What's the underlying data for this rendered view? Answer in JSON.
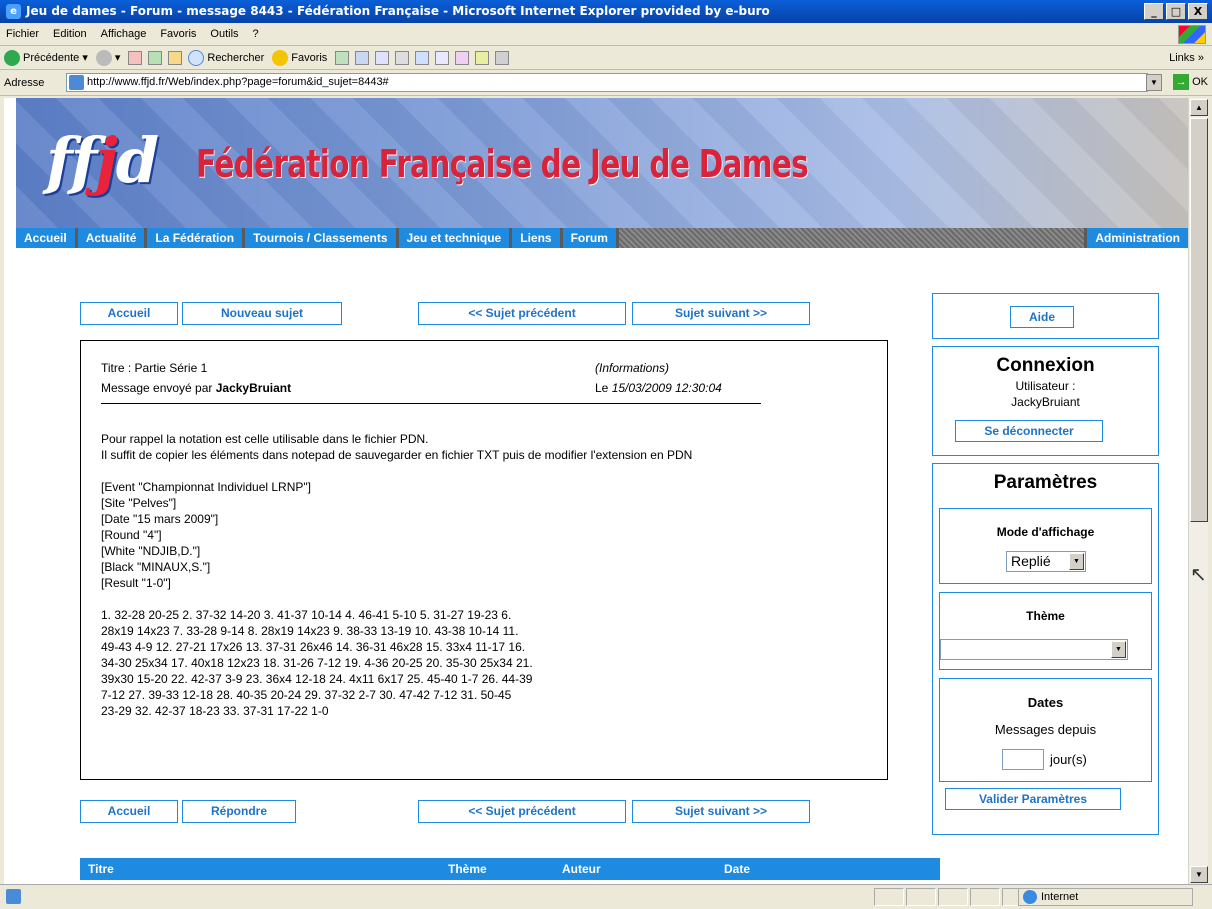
{
  "window": {
    "title": "Jeu de dames - Forum - message 8443 - Fédération Française - Microsoft Internet Explorer provided by e-buro",
    "min": "_",
    "max": "□",
    "close": "X"
  },
  "menu": [
    "Fichier",
    "Edition",
    "Affichage",
    "Favoris",
    "Outils",
    "?"
  ],
  "toolbar": {
    "back": "Précédente",
    "search": "Rechercher",
    "favorites": "Favoris",
    "links": "Links"
  },
  "address": {
    "label": "Adresse",
    "url": "http://www.ffjd.fr/Web/index.php?page=forum&id_sujet=8443#",
    "go": "OK"
  },
  "banner": {
    "logo_a": "ff",
    "logo_b": "j",
    "logo_c": "d",
    "title": "Fédération Française de Jeu de Dames"
  },
  "nav": [
    "Accueil",
    "Actualité",
    "La Fédération",
    "Tournois / Classements",
    "Jeu et technique",
    "Liens",
    "Forum"
  ],
  "nav_admin": "Administration",
  "buttons_top": {
    "home": "Accueil",
    "new_topic": "Nouveau sujet",
    "prev": "<< Sujet précédent",
    "next": "Sujet suivant >>"
  },
  "buttons_bottom": {
    "home": "Accueil",
    "reply": "Répondre",
    "prev": "<< Sujet précédent",
    "next": "Sujet suivant >>"
  },
  "message": {
    "title": "Titre : Partie Série 1",
    "sent_by_label": "Message envoyé par ",
    "author": "JackyBruiant",
    "info": "(Informations)",
    "date_prefix": "Le ",
    "date": "15/03/2009 12:30:04",
    "intro": "Pour rappel la notation est celle utilisable dans le fichier PDN.\nIl suffit de copier les éléments dans notepad de sauvegarder en fichier TXT puis de modifier l'extension en PDN",
    "tags": "[Event \"Championnat Individuel LRNP\"]\n[Site \"Pelves\"]\n[Date \"15 mars 2009\"]\n[Round \"4\"]\n[White \"NDJIB,D.\"]\n[Black \"MINAUX,S.\"]\n[Result \"1-0\"]",
    "moves": "1. 32-28 20-25 2. 37-32 14-20 3. 41-37 10-14 4. 46-41 5-10 5. 31-27 19-23 6.\n28x19 14x23 7. 33-28 9-14 8. 28x19 14x23 9. 38-33 13-19 10. 43-38 10-14 11.\n49-43 4-9 12. 27-21 17x26 13. 37-31 26x46 14. 36-31 46x28 15. 33x4 11-17 16.\n34-30 25x34 17. 40x18 12x23 18. 31-26 7-12 19. 4-36 20-25 20. 35-30 25x34 21.\n39x30 15-20 22. 42-37 3-9 23. 36x4 12-18 24. 4x11 6x17 25. 45-40 1-7 26. 44-39\n7-12 27. 39-33 12-18 28. 40-35 20-24 29. 37-32 2-7 30. 47-42 7-12 31. 50-45\n23-29 32. 42-37 18-23 33. 37-31 17-22 1-0"
  },
  "sidebar": {
    "help": "Aide",
    "connexion_title": "Connexion",
    "user_label": "Utilisateur :",
    "user_name": "JackyBruiant",
    "logout": "Se déconnecter",
    "params_title": "Paramètres",
    "display_mode_label": "Mode d'affichage",
    "display_mode_value": "Replié",
    "theme_label": "Thème",
    "theme_value": "",
    "dates_label": "Dates",
    "messages_since": "Messages depuis",
    "days_value": "",
    "days_unit": "jour(s)",
    "validate": "Valider Paramètres"
  },
  "table_header": [
    "Titre",
    "Thème",
    "Auteur",
    "Date"
  ],
  "status": {
    "zone": "Internet"
  }
}
